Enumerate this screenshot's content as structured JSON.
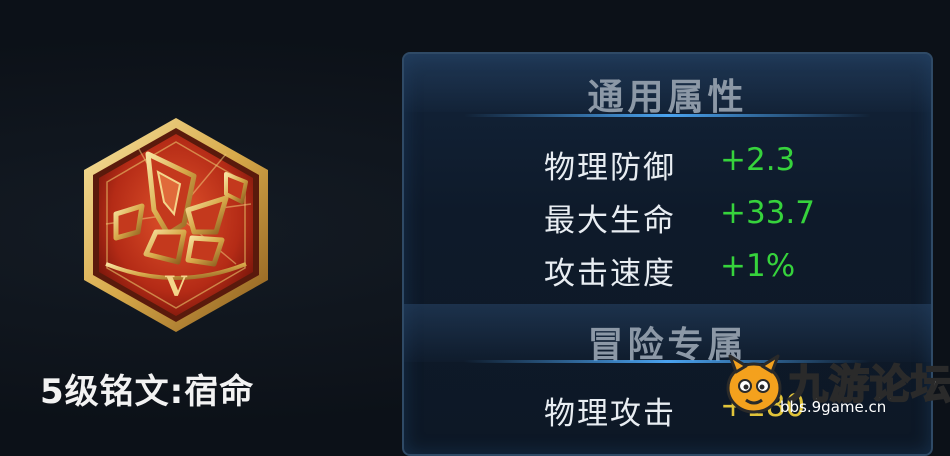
{
  "rune": {
    "tier_numeral": "V",
    "name": "5级铭文:宿命"
  },
  "panel": {
    "general_title": "通用属性",
    "general_attrs": [
      {
        "name": "物理防御",
        "value": "+2.3"
      },
      {
        "name": "最大生命",
        "value": "+33.7"
      },
      {
        "name": "攻击速度",
        "value": "+1%"
      }
    ],
    "adventure_title": "冒险专属",
    "adventure_attrs": [
      {
        "name": "物理攻击",
        "value": "+180"
      }
    ]
  },
  "watermark": {
    "brand": "九游论坛",
    "url": "bbs.9game.cn"
  },
  "colors": {
    "background": "#0c1118",
    "panel_border": "#2f4a66",
    "attr_value": "#36d33c",
    "rune_red": "#c8381c",
    "rune_gold": "#e9c46a"
  }
}
